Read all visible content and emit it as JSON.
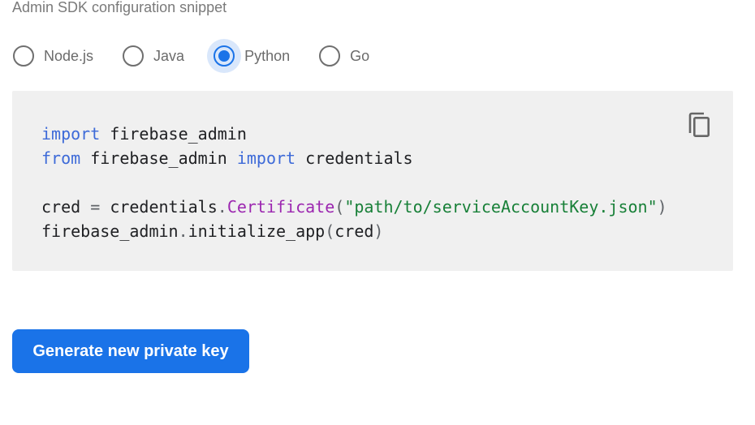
{
  "section": {
    "label": "Admin SDK configuration snippet"
  },
  "languages": {
    "options": [
      {
        "label": "Node.js",
        "selected": false
      },
      {
        "label": "Java",
        "selected": false
      },
      {
        "label": "Python",
        "selected": true
      },
      {
        "label": "Go",
        "selected": false
      }
    ],
    "selected": "Python"
  },
  "code": {
    "language": "python",
    "lines": [
      "import firebase_admin",
      "from firebase_admin import credentials",
      "",
      "cred = credentials.Certificate(\"path/to/serviceAccountKey.json\")",
      "firebase_admin.initialize_app(cred)"
    ],
    "tokens": {
      "kw_import": "import",
      "kw_from": "from",
      "module": "firebase_admin",
      "credentials": "credentials",
      "cred": "cred",
      "equals": "=",
      "dot": ".",
      "certificate": "Certificate",
      "open_paren": "(",
      "close_paren": ")",
      "path_string": "\"path/to/serviceAccountKey.json\"",
      "initialize_app": "initialize_app"
    },
    "copy_icon": "copy-icon"
  },
  "actions": {
    "generate_label": "Generate new private key"
  },
  "colors": {
    "accent": "#1a73e8",
    "code_background": "#f0f0f0",
    "keyword": "#3d6ad8",
    "function": "#9c27b0",
    "string": "#188038"
  }
}
